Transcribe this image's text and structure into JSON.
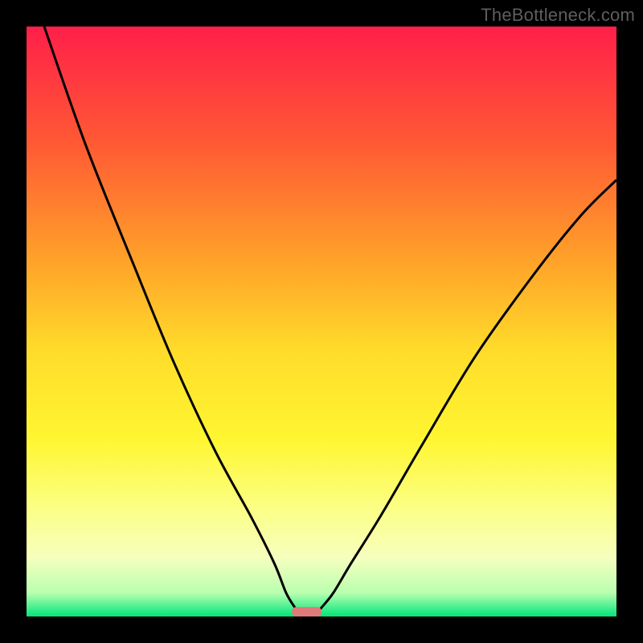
{
  "watermark": "TheBottleneck.com",
  "chart_data": {
    "type": "line",
    "title": "",
    "xlabel": "",
    "ylabel": "",
    "xlim": [
      0,
      100
    ],
    "ylim": [
      0,
      100
    ],
    "gradient_stops": [
      {
        "offset": 0.0,
        "color": "#ff1f49"
      },
      {
        "offset": 0.2,
        "color": "#ff5a34"
      },
      {
        "offset": 0.4,
        "color": "#ffa329"
      },
      {
        "offset": 0.55,
        "color": "#ffdc2a"
      },
      {
        "offset": 0.7,
        "color": "#fff631"
      },
      {
        "offset": 0.82,
        "color": "#fbff87"
      },
      {
        "offset": 0.9,
        "color": "#f6ffbe"
      },
      {
        "offset": 0.96,
        "color": "#b9ffb0"
      },
      {
        "offset": 1.0,
        "color": "#00e67a"
      }
    ],
    "series": [
      {
        "name": "left-branch",
        "x": [
          3,
          10,
          18,
          25,
          32,
          38,
          42,
          44,
          45.5,
          46.2
        ],
        "y": [
          100,
          80,
          60,
          43,
          28,
          17,
          9,
          4,
          1.5,
          0.5
        ]
      },
      {
        "name": "right-branch",
        "x": [
          49.2,
          50,
          52,
          55,
          60,
          67,
          76,
          86,
          94,
          100
        ],
        "y": [
          0.5,
          1.5,
          4,
          9,
          17,
          29,
          44,
          58,
          68,
          74
        ]
      }
    ],
    "marker": {
      "name": "min-marker",
      "x": 47.5,
      "width_pct": 5.0,
      "height_pct": 1.6,
      "fill": "#e07a7a"
    }
  }
}
